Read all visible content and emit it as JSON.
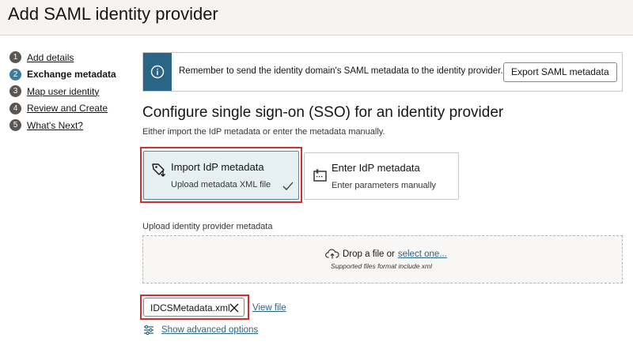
{
  "header": {
    "title": "Add SAML identity provider"
  },
  "steps": [
    {
      "num": "1",
      "label": "Add details"
    },
    {
      "num": "2",
      "label": "Exchange metadata"
    },
    {
      "num": "3",
      "label": "Map user identity"
    },
    {
      "num": "4",
      "label": "Review and Create"
    },
    {
      "num": "5",
      "label": "What's Next?"
    }
  ],
  "banner": {
    "icon": "info-icon",
    "text": "Remember to send the identity domain's SAML metadata to the identity provider.",
    "button_label": "Export SAML metadata"
  },
  "sso": {
    "title": "Configure single sign-on (SSO) for an identity provider",
    "description": "Either import the IdP metadata or enter the metadata manually."
  },
  "options": [
    {
      "title": "Import IdP metadata",
      "subtitle": "Upload metadata XML file",
      "icon": "tag-download-icon",
      "selected": true
    },
    {
      "title": "Enter IdP metadata",
      "subtitle": "Enter parameters manually",
      "icon": "form-entry-icon",
      "selected": false
    }
  ],
  "upload": {
    "label": "Upload identity provider metadata",
    "drop_text": "Drop a file or",
    "drop_link": "select one...",
    "hint": "Supported files format include xml"
  },
  "file": {
    "name": "IDCSMetadata.xml",
    "view_label": "View file"
  },
  "advanced": {
    "label": "Show advanced options"
  },
  "colors": {
    "accent": "#2b6585",
    "selected_bg": "#e6f0f3",
    "highlight": "#d32f2f",
    "step_active": "#3a7c9c"
  }
}
